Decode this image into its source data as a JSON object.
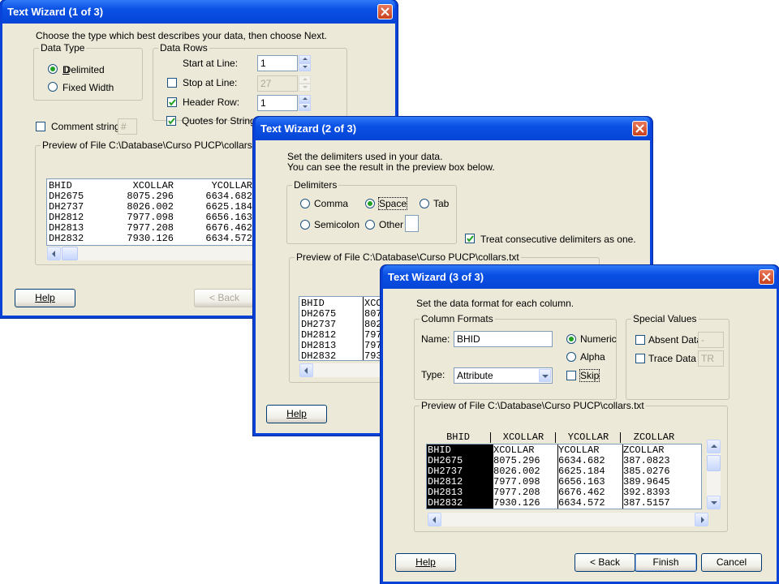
{
  "wizard1": {
    "title": "Text Wizard (1 of 3)",
    "instruction": "Choose the type which best describes your data, then choose Next.",
    "data_type": {
      "label": "Data Type",
      "delimited": "Delimited",
      "fixed_width": "Fixed Width",
      "selected": "delimited"
    },
    "data_rows": {
      "label": "Data Rows",
      "start_label": "Start at Line:",
      "start_value": "1",
      "stop_label": "Stop at Line:",
      "stop_value": "27",
      "header_label": "Header Row:",
      "header_value": "1",
      "quotes_label": "Quotes for Strings"
    },
    "comment_label": "Comment string:",
    "comment_value": "#",
    "preview_label": "Preview of File C:\\Database\\Curso PUCP\\collars.txt",
    "preview_rows": [
      [
        "BHID",
        "XCOLLAR",
        "YCOLLAR"
      ],
      [
        "DH2675",
        "8075.296",
        "6634.682"
      ],
      [
        "DH2737",
        "8026.002",
        "6625.184"
      ],
      [
        "DH2812",
        "7977.098",
        "6656.163"
      ],
      [
        "DH2813",
        "7977.208",
        "6676.462"
      ],
      [
        "DH2832",
        "7930.126",
        "6634.572"
      ]
    ],
    "help_label": "Help",
    "back_label": "< Back"
  },
  "wizard2": {
    "title": "Text Wizard (2 of 3)",
    "instruction_line1": "Set the delimiters used in your data.",
    "instruction_line2": "You can see the result in the preview box below.",
    "delimiters_label": "Delimiters",
    "comma": "Comma",
    "space": "Space",
    "tab": "Tab",
    "semicolon": "Semicolon",
    "other": "Other",
    "selected": "space",
    "consecutive_label": "Treat consecutive delimiters as one.",
    "preview_label": "Preview of File C:\\Database\\Curso PUCP\\collars.txt",
    "preview_rows": [
      [
        "BHID",
        "XCO"
      ],
      [
        "DH2675",
        "807"
      ],
      [
        "DH2737",
        "802"
      ],
      [
        "DH2812",
        "797"
      ],
      [
        "DH2813",
        "797"
      ],
      [
        "DH2832",
        "793"
      ]
    ],
    "help_label": "Help"
  },
  "wizard3": {
    "title": "Text Wizard (3 of 3)",
    "instruction": "Set the data format for each column.",
    "column_formats_label": "Column Formats",
    "name_label": "Name:",
    "name_value": "BHID",
    "numeric_label": "Numeric",
    "alpha_label": "Alpha",
    "skip_label": "Skip",
    "type_label": "Type:",
    "type_value": "Attribute",
    "special_values_label": "Special Values",
    "absent_label": "Absent Data",
    "absent_value": "-",
    "trace_label": "Trace Data",
    "trace_value": "TR",
    "preview_label": "Preview of File C:\\Database\\Curso PUCP\\collars.txt",
    "headers": [
      "BHID",
      "XCOLLAR",
      "YCOLLAR",
      "ZCOLLAR"
    ],
    "rows": [
      [
        "BHID",
        "XCOLLAR",
        "YCOLLAR",
        "ZCOLLAR"
      ],
      [
        "DH2675",
        "8075.296",
        "6634.682",
        "387.0823"
      ],
      [
        "DH2737",
        "8026.002",
        "6625.184",
        "385.0276"
      ],
      [
        "DH2812",
        "7977.098",
        "6656.163",
        "389.9645"
      ],
      [
        "DH2813",
        "7977.208",
        "6676.462",
        "392.8393"
      ],
      [
        "DH2832",
        "7930.126",
        "6634.572",
        "387.5157"
      ]
    ],
    "help_label": "Help",
    "back_label": "< Back",
    "finish_label": "Finish",
    "cancel_label": "Cancel"
  }
}
